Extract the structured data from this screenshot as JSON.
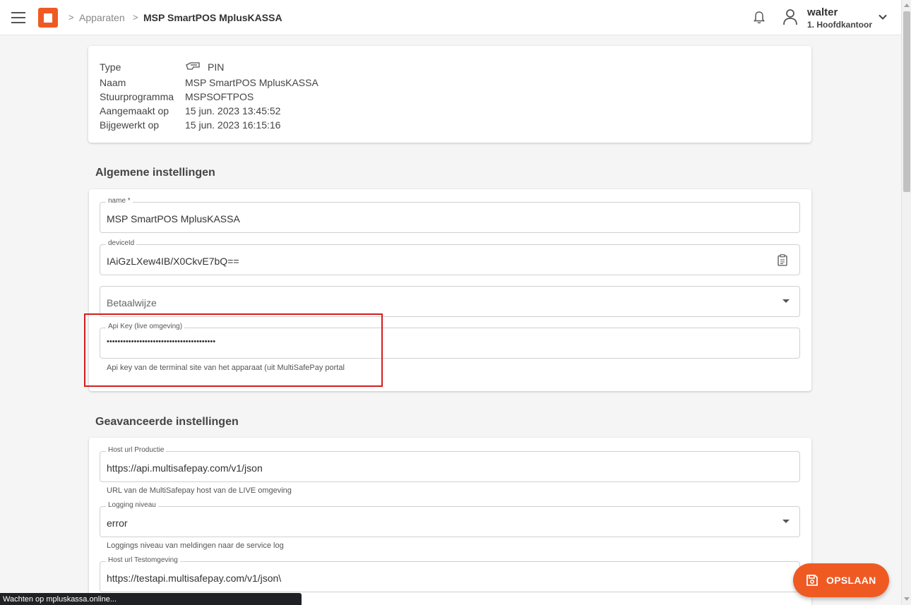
{
  "header": {
    "breadcrumb": {
      "parent": "Apparaten",
      "current": "MSP SmartPOS MplusKASSA"
    },
    "user": {
      "name": "walter",
      "branch": "1. Hoofdkantoor"
    }
  },
  "info": {
    "rows": [
      {
        "label": "Type",
        "value": "PIN"
      },
      {
        "label": "Naam",
        "value": "MSP SmartPOS MplusKASSA"
      },
      {
        "label": "Stuurprogramma",
        "value": "MSPSOFTPOS"
      },
      {
        "label": "Aangemaakt op",
        "value": "15 jun. 2023 13:45:52"
      },
      {
        "label": "Bijgewerkt op",
        "value": "15 jun. 2023 16:15:16"
      }
    ]
  },
  "general": {
    "title": "Algemene instellingen",
    "name_field": {
      "label": "name *",
      "value": "MSP SmartPOS MplusKASSA"
    },
    "device_field": {
      "label": "deviceId",
      "value": "IAiGzLXew4IB/X0CkvE7bQ=="
    },
    "payment_field": {
      "placeholder": "Betaalwijze"
    },
    "apikey_field": {
      "label": "Api Key (live omgeving)",
      "value": "••••••••••••••••••••••••••••••••••••••••",
      "hint": "Api key van de terminal site van het apparaat (uit MultiSafePay portal"
    }
  },
  "advanced": {
    "title": "Geavanceerde instellingen",
    "host_prod": {
      "label": "Host url Productie",
      "value": "https://api.multisafepay.com/v1/json",
      "hint": "URL van de MultiSafepay host van de LIVE omgeving"
    },
    "logging": {
      "label": "Logging niveau",
      "value": "error",
      "hint": "Loggings niveau van meldingen naar de service log"
    },
    "host_test": {
      "label": "Host url Testomgeving",
      "value": "https://testapi.multisafepay.com/v1/json\\"
    }
  },
  "save_label": "OPSLAAN",
  "status": "Wachten op mpluskassa.online...",
  "colors": {
    "accent": "#ef5a23",
    "highlight": "#d41d1d"
  }
}
